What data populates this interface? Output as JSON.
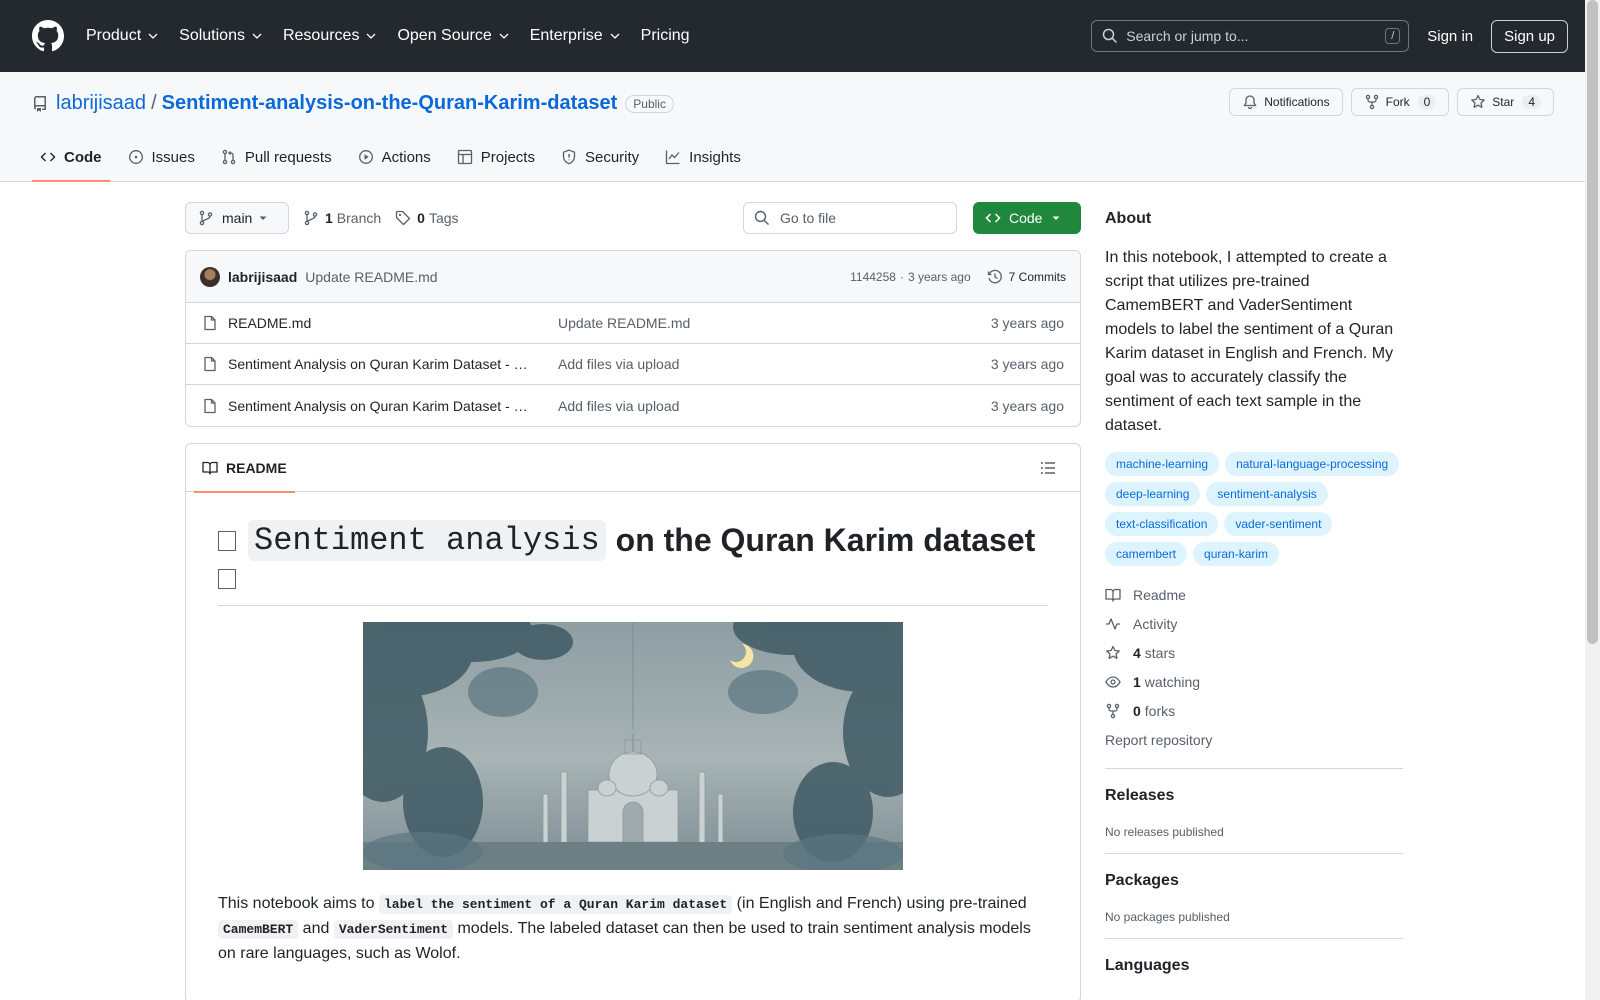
{
  "header": {
    "nav": [
      "Product",
      "Solutions",
      "Resources",
      "Open Source",
      "Enterprise",
      "Pricing"
    ],
    "search_placeholder": "Search or jump to...",
    "search_shortcut": "/",
    "signin": "Sign in",
    "signup": "Sign up"
  },
  "repo": {
    "owner": "labrijisaad",
    "separator": "/",
    "name": "Sentiment-analysis-on-the-Quran-Karim-dataset",
    "visibility": "Public",
    "notifications_label": "Notifications",
    "fork_label": "Fork",
    "fork_count": "0",
    "star_label": "Star",
    "star_count": "4",
    "tabs": [
      "Code",
      "Issues",
      "Pull requests",
      "Actions",
      "Projects",
      "Security",
      "Insights"
    ]
  },
  "toolbar": {
    "branch": "main",
    "branch_count": "1",
    "branch_label": "Branch",
    "tag_count": "0",
    "tag_label": "Tags",
    "goto_placeholder": "Go to file",
    "code_label": "Code"
  },
  "latest_commit": {
    "author": "labrijisaad",
    "message": "Update README.md",
    "hash": "1144258",
    "separator": "·",
    "time": "3 years ago",
    "commits_label": "7 Commits"
  },
  "files": [
    {
      "name": "README.md",
      "commit": "Update README.md",
      "date": "3 years ago"
    },
    {
      "name": "Sentiment Analysis on Quran Karim Dataset - …",
      "commit": "Add files via upload",
      "date": "3 years ago"
    },
    {
      "name": "Sentiment Analysis on Quran Karim Dataset - …",
      "commit": "Add files via upload",
      "date": "3 years ago"
    }
  ],
  "readme": {
    "tab_label": "README",
    "title_code": "Sentiment analysis",
    "title_rest": "on the Quran Karim dataset",
    "para_1": "This notebook aims to ",
    "para_code_1": "label the sentiment of a Quran Karim dataset",
    "para_2": " (in English and French) using pre-trained ",
    "para_code_2": "CamemBERT",
    "para_3": " and ",
    "para_code_3": "VaderSentiment",
    "para_4": " models. The labeled dataset can then be used to train sentiment analysis models on rare languages, such as Wolof."
  },
  "about": {
    "heading": "About",
    "description": "In this notebook, I attempted to create a script that utilizes pre-trained CamemBERT and VaderSentiment models to label the sentiment of a Quran Karim dataset in English and French. My goal was to accurately classify the sentiment of each text sample in the dataset.",
    "topics": [
      "machine-learning",
      "natural-language-processing",
      "deep-learning",
      "sentiment-analysis",
      "text-classification",
      "vader-sentiment",
      "camembert",
      "quran-karim"
    ],
    "readme_link": "Readme",
    "activity_link": "Activity",
    "stars_count": "4",
    "stars_label": "stars",
    "watching_count": "1",
    "watching_label": "watching",
    "forks_count": "0",
    "forks_label": "forks",
    "report": "Report repository"
  },
  "releases": {
    "heading": "Releases",
    "text": "No releases published"
  },
  "packages": {
    "heading": "Packages",
    "text": "No packages published"
  },
  "languages": {
    "heading": "Languages"
  }
}
